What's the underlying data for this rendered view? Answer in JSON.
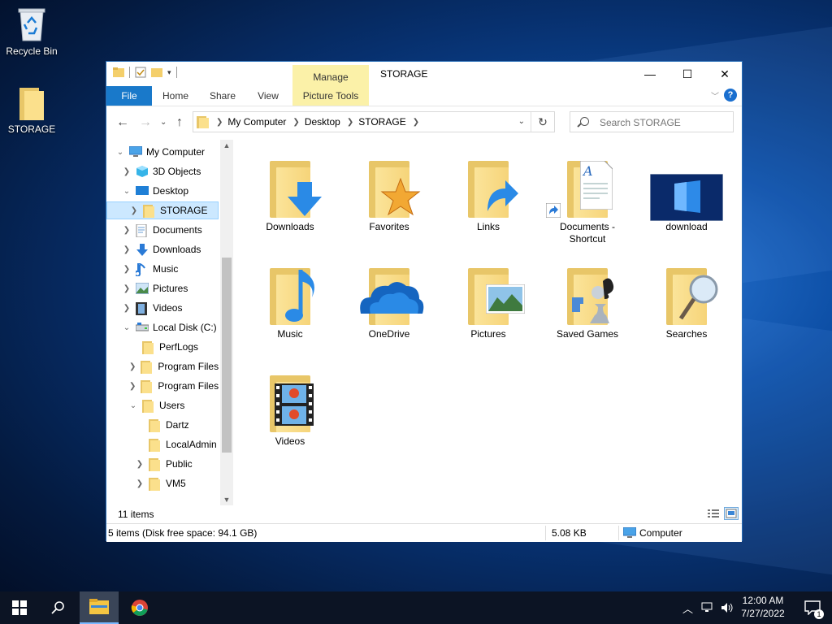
{
  "desktop": {
    "icons": [
      {
        "label": "Recycle Bin"
      },
      {
        "label": "STORAGE"
      }
    ]
  },
  "window": {
    "title": "STORAGE",
    "contextual_tab_group": "Manage",
    "ribbon_tabs": [
      "File",
      "Home",
      "Share",
      "View",
      "Picture Tools"
    ],
    "controls": {
      "minimize": "—",
      "maximize": "☐",
      "close": "✕"
    }
  },
  "address": {
    "crumbs": [
      "My Computer",
      "Desktop",
      "STORAGE"
    ],
    "search_placeholder": "Search STORAGE"
  },
  "nav_tree": [
    {
      "label": "My Computer",
      "indent": 0,
      "chev": "down",
      "icon": "computer-icon"
    },
    {
      "label": "3D Objects",
      "indent": 1,
      "chev": "right",
      "icon": "3d-objects-icon"
    },
    {
      "label": "Desktop",
      "indent": 1,
      "chev": "down",
      "icon": "desktop-icon"
    },
    {
      "label": "STORAGE",
      "indent": 2,
      "chev": "right",
      "icon": "folder-icon",
      "selected": true
    },
    {
      "label": "Documents",
      "indent": 1,
      "chev": "right",
      "icon": "documents-icon"
    },
    {
      "label": "Downloads",
      "indent": 1,
      "chev": "right",
      "icon": "downloads-icon"
    },
    {
      "label": "Music",
      "indent": 1,
      "chev": "right",
      "icon": "music-icon"
    },
    {
      "label": "Pictures",
      "indent": 1,
      "chev": "right",
      "icon": "pictures-icon"
    },
    {
      "label": "Videos",
      "indent": 1,
      "chev": "right",
      "icon": "videos-icon"
    },
    {
      "label": "Local Disk (C:)",
      "indent": 1,
      "chev": "down",
      "icon": "drive-icon"
    },
    {
      "label": "PerfLogs",
      "indent": 2,
      "chev": "",
      "icon": "folder-icon"
    },
    {
      "label": "Program Files",
      "indent": 2,
      "chev": "right",
      "icon": "folder-icon"
    },
    {
      "label": "Program Files (",
      "indent": 2,
      "chev": "right",
      "icon": "folder-icon"
    },
    {
      "label": "Users",
      "indent": 2,
      "chev": "down",
      "icon": "folder-icon"
    },
    {
      "label": "Dartz",
      "indent": 3,
      "chev": "",
      "icon": "folder-icon"
    },
    {
      "label": "LocalAdmin",
      "indent": 3,
      "chev": "",
      "icon": "folder-icon"
    },
    {
      "label": "Public",
      "indent": 3,
      "chev": "right",
      "icon": "folder-icon"
    },
    {
      "label": "VM5",
      "indent": 3,
      "chev": "right",
      "icon": "folder-icon"
    }
  ],
  "items": [
    {
      "label": "Downloads",
      "overlay": "download-arrow"
    },
    {
      "label": "Favorites",
      "overlay": "star"
    },
    {
      "label": "Links",
      "overlay": "link-arrow"
    },
    {
      "label": "Documents - Shortcut",
      "overlay": "document"
    },
    {
      "label": "download",
      "overlay": "image-thumbnail"
    },
    {
      "label": "Music",
      "overlay": "music-note"
    },
    {
      "label": "OneDrive",
      "overlay": "cloud"
    },
    {
      "label": "Pictures",
      "overlay": "landscape"
    },
    {
      "label": "Saved Games",
      "overlay": "chess-pawn"
    },
    {
      "label": "Searches",
      "overlay": "magnifier"
    },
    {
      "label": "Videos",
      "overlay": "filmstrip"
    }
  ],
  "status": {
    "count": "11 items",
    "disk": "5 items (Disk free space: 94.1 GB)",
    "size": "5.08 KB",
    "location": "Computer"
  },
  "taskbar": {
    "clock_time": "12:00 AM",
    "clock_date": "7/27/2022",
    "notification_count": "1"
  }
}
